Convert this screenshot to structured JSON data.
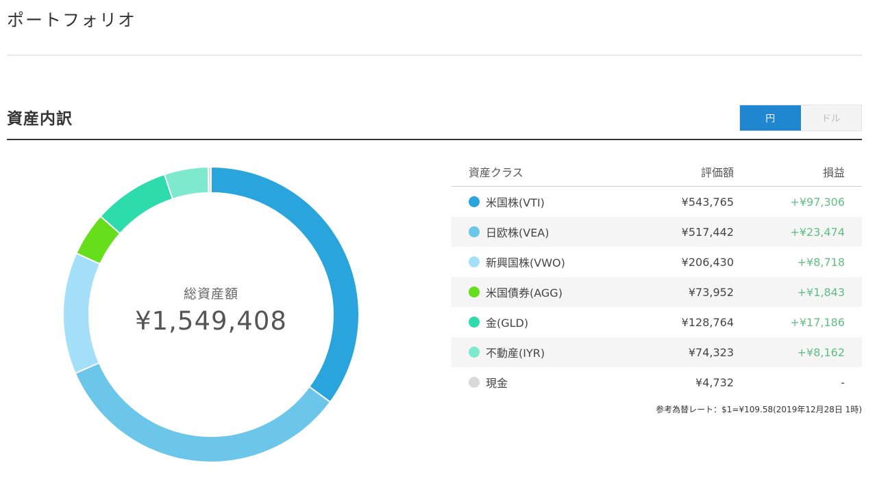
{
  "page": {
    "title": "ポートフォリオ"
  },
  "section": {
    "title": "資産内訳",
    "currency_toggle": {
      "yen_label": "円",
      "usd_label": "ドル",
      "selected": "円"
    }
  },
  "donut": {
    "center_label": "総資産額",
    "center_value": "¥1,549,408"
  },
  "table": {
    "headers": {
      "asset_class": "資産クラス",
      "value": "評価額",
      "gain": "損益"
    },
    "rows": [
      {
        "name": "米国株(VTI)",
        "value": "¥543,765",
        "gain": "+¥97,306",
        "color": "#29a4dc"
      },
      {
        "name": "日欧株(VEA)",
        "value": "¥517,442",
        "gain": "+¥23,474",
        "color": "#6bc6ea"
      },
      {
        "name": "新興国株(VWO)",
        "value": "¥206,430",
        "gain": "+¥8,718",
        "color": "#a3dff8"
      },
      {
        "name": "米国債券(AGG)",
        "value": "¥73,952",
        "gain": "+¥1,843",
        "color": "#66de1c"
      },
      {
        "name": "金(GLD)",
        "value": "¥128,764",
        "gain": "+¥17,186",
        "color": "#2ddbad"
      },
      {
        "name": "不動産(IYR)",
        "value": "¥74,323",
        "gain": "+¥8,162",
        "color": "#7fe9cd"
      },
      {
        "name": "現金",
        "value": "¥4,732",
        "gain": "-",
        "color": "#d9d9d9"
      }
    ]
  },
  "footnote": "参考為替レート：$1=¥109.58(2019年12月28日 1時)",
  "chart_data": {
    "type": "pie",
    "categories": [
      "米国株(VTI)",
      "日欧株(VEA)",
      "新興国株(VWO)",
      "米国債券(AGG)",
      "金(GLD)",
      "不動産(IYR)",
      "現金"
    ],
    "values": [
      543765,
      517442,
      206430,
      73952,
      128764,
      74323,
      4732
    ],
    "colors": [
      "#29a4dc",
      "#6bc6ea",
      "#a3dff8",
      "#66de1c",
      "#2ddbad",
      "#7fe9cd",
      "#d9d9d9"
    ],
    "donut": true,
    "start": "top",
    "direction": "clockwise"
  }
}
